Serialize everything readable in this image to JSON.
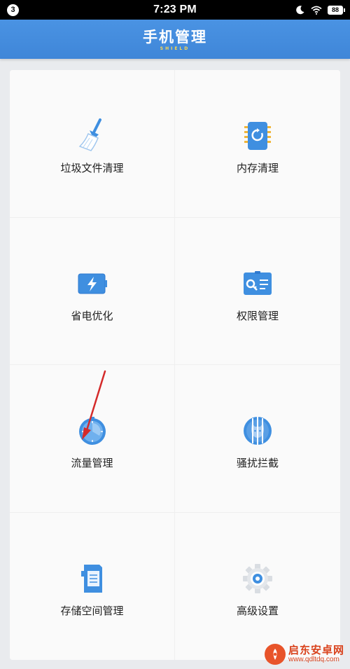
{
  "status_bar": {
    "notification_count": "3",
    "time": "7:23 PM",
    "battery": "88"
  },
  "header": {
    "title": "手机管理",
    "subtitle": "SHIELD"
  },
  "tiles": [
    {
      "label": "垃圾文件清理",
      "icon": "broom-icon"
    },
    {
      "label": "内存清理",
      "icon": "memory-chip-icon"
    },
    {
      "label": "省电优化",
      "icon": "battery-bolt-icon"
    },
    {
      "label": "权限管理",
      "icon": "key-card-icon"
    },
    {
      "label": "流量管理",
      "icon": "clock-gauge-icon"
    },
    {
      "label": "骚扰拦截",
      "icon": "caged-cat-icon"
    },
    {
      "label": "存储空间管理",
      "icon": "sd-card-icon"
    },
    {
      "label": "高级设置",
      "icon": "gear-icon"
    }
  ],
  "watermark": {
    "name": "启东安卓网",
    "url": "www.qdltdq.com"
  },
  "colors": {
    "header_blue": "#4a93e3",
    "icon_blue": "#3f8fe0",
    "accent_yellow": "#ffd84a",
    "annotation_red": "#d42a2a"
  }
}
